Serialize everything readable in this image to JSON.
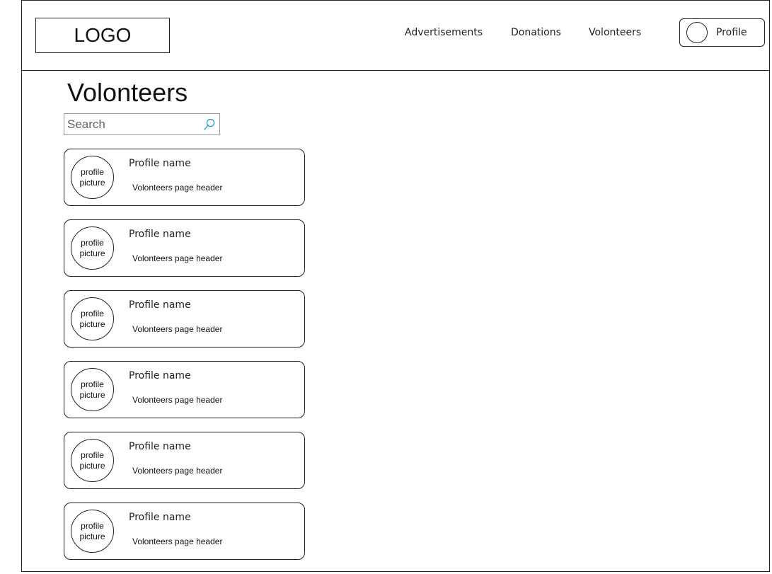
{
  "header": {
    "logo_text": "LOGO",
    "nav": {
      "advertisements": "Advertisements",
      "donations": "Donations",
      "volonteers": "Volonteers"
    },
    "profile_label": "Profile"
  },
  "main": {
    "title": "Volonteers",
    "search": {
      "placeholder": "Search",
      "value": ""
    },
    "cards": [
      {
        "picture_line1": "profile",
        "picture_line2": "picture",
        "name": "Profile name",
        "subtitle": "Volonteers page header"
      },
      {
        "picture_line1": "profile",
        "picture_line2": "picture",
        "name": "Profile name",
        "subtitle": "Volonteers page header"
      },
      {
        "picture_line1": "profile",
        "picture_line2": "picture",
        "name": "Profile name",
        "subtitle": "Volonteers page header"
      },
      {
        "picture_line1": "profile",
        "picture_line2": "picture",
        "name": "Profile name",
        "subtitle": "Volonteers page header"
      },
      {
        "picture_line1": "profile",
        "picture_line2": "picture",
        "name": "Profile name",
        "subtitle": "Volonteers page header"
      },
      {
        "picture_line1": "profile",
        "picture_line2": "picture",
        "name": "Profile name",
        "subtitle": "Volonteers page header"
      }
    ]
  },
  "icons": {
    "search": "search-icon",
    "avatar": "avatar-circle"
  },
  "colors": {
    "outline": "#222222",
    "search_icon": "#1a9bd7"
  }
}
